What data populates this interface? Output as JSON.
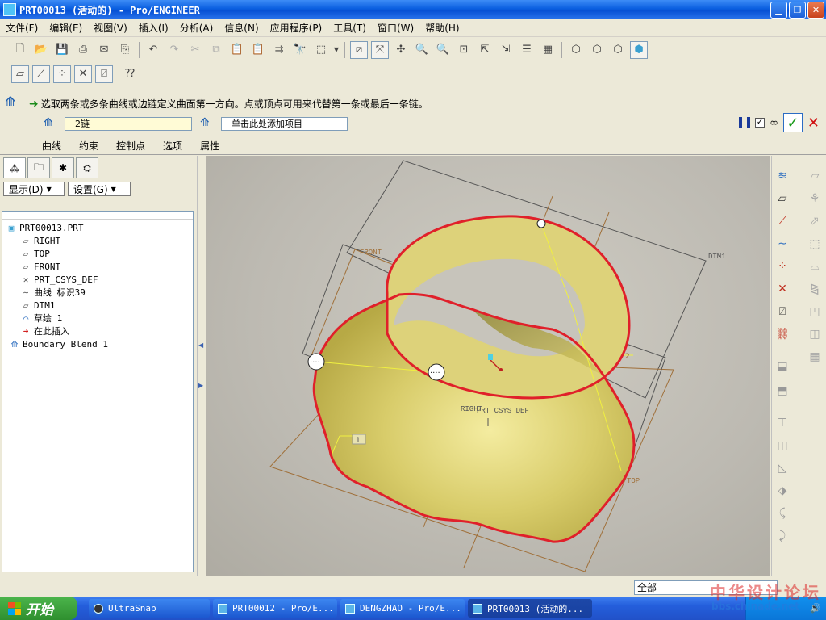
{
  "window": {
    "title": "PRT00013 (活动的) - Pro/ENGINEER"
  },
  "menubar": {
    "items": [
      "文件(F)",
      "编辑(E)",
      "视图(V)",
      "插入(I)",
      "分析(A)",
      "信息(N)",
      "应用程序(P)",
      "工具(T)",
      "窗口(W)",
      "帮助(H)"
    ]
  },
  "dashboard": {
    "message": "选取两条或多条曲线或边链定义曲面第一方向。点或顶点可用来代替第一条或最后一条链。",
    "collector1_value": "2链",
    "collector2_value": "单击此处添加项目",
    "tabs": [
      "曲线",
      "约束",
      "控制点",
      "选项",
      "属性"
    ],
    "preview_checked": "✓"
  },
  "tree": {
    "display_label": "显示(D)",
    "settings_label": "设置(G)",
    "items": [
      {
        "label": "PRT00013.PRT",
        "icon": "part-icon"
      },
      {
        "label": "RIGHT",
        "icon": "datum-plane-icon"
      },
      {
        "label": "TOP",
        "icon": "datum-plane-icon"
      },
      {
        "label": "FRONT",
        "icon": "datum-plane-icon"
      },
      {
        "label": "PRT_CSYS_DEF",
        "icon": "csys-icon"
      },
      {
        "label": "曲线 标识39",
        "icon": "curve-icon"
      },
      {
        "label": "DTM1",
        "icon": "datum-plane-icon"
      },
      {
        "label": "草绘 1",
        "icon": "sketch-icon"
      },
      {
        "label": "在此插入",
        "icon": "insert-here-icon"
      },
      {
        "label": "Boundary Blend 1",
        "icon": "boundary-blend-icon"
      }
    ]
  },
  "graphics": {
    "labels": {
      "front": "FRONT",
      "dtm1": "DTM1",
      "top": "TOP",
      "right": "RIGHT",
      "csys": "PRT_CSYS_DEF",
      "chain1": "1",
      "chain2": "2"
    },
    "colors": {
      "surface": "#d8cc6a",
      "boundary": "#e0202a",
      "datum": "#a0703a",
      "guide": "#f0f040"
    }
  },
  "statusbar": {
    "filter_value": "全部"
  },
  "taskbar": {
    "start_label": "开始",
    "buttons": [
      "UltraSnap",
      "PRT00012 - Pro/E...",
      "DENGZHAO - Pro/E...",
      "PRT00013 (活动的..."
    ]
  },
  "watermark": {
    "title": "中华设计论坛",
    "url": "bbs.chinade.net"
  }
}
